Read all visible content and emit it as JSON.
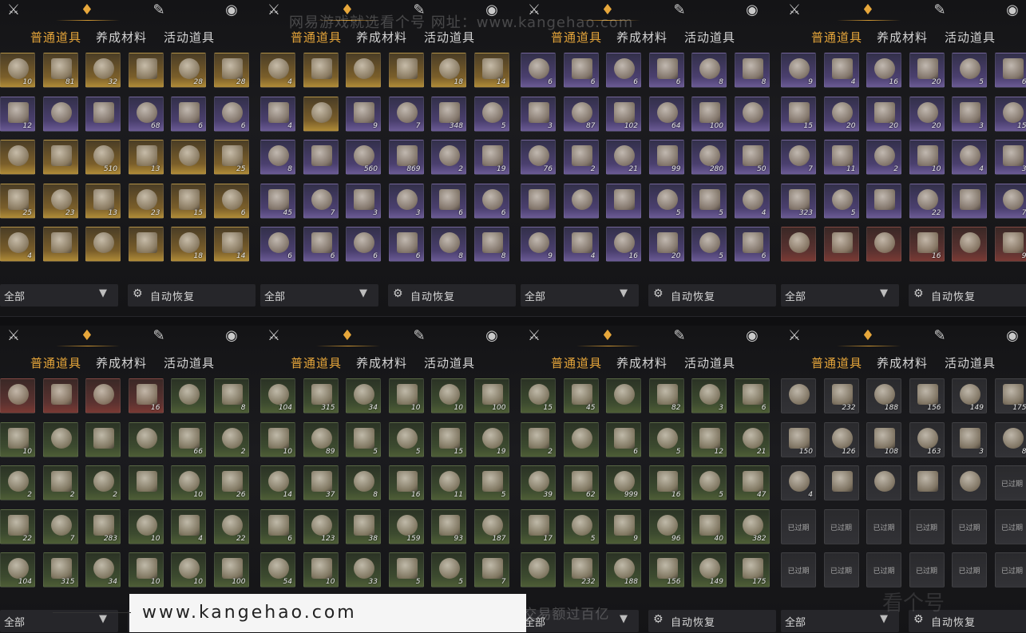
{
  "tabs": [
    "普通道具",
    "养成材料",
    "活动道具"
  ],
  "filter_label": "全部",
  "auto_restore_label": "自动恢复",
  "watermark_top": "网易游戏就选看个号  网址：www.kangehao.com",
  "watermark_bottom": "一号一号专业网易游戏八年  年交易额过百亿",
  "watermark_logo": "看个号",
  "url_banner": "www.kangehao.com",
  "panels": [
    {
      "rows": [
        [
          [
            "gold",
            "10"
          ],
          [
            "gold",
            "81"
          ],
          [
            "gold",
            "32"
          ],
          [
            "gold",
            ""
          ],
          [
            "gold",
            "28"
          ],
          [
            "gold",
            "28"
          ]
        ],
        [
          [
            "purple",
            "12"
          ],
          [
            "purple",
            ""
          ],
          [
            "purple",
            ""
          ],
          [
            "purple",
            "68"
          ],
          [
            "purple",
            "6"
          ],
          [
            "purple",
            "6"
          ]
        ],
        [
          [
            "gold",
            ""
          ],
          [
            "gold",
            ""
          ],
          [
            "gold",
            "510"
          ],
          [
            "gold",
            "13"
          ],
          [
            "gold",
            ""
          ],
          [
            "gold",
            "25"
          ]
        ],
        [
          [
            "gold",
            "25"
          ],
          [
            "gold",
            "23"
          ],
          [
            "gold",
            "13"
          ],
          [
            "gold",
            "23"
          ],
          [
            "gold",
            "15"
          ],
          [
            "gold",
            "6"
          ]
        ],
        [
          [
            "gold",
            "4"
          ],
          [
            "gold",
            ""
          ],
          [
            "gold",
            ""
          ],
          [
            "gold",
            ""
          ],
          [
            "gold",
            "18"
          ],
          [
            "gold",
            "14"
          ]
        ]
      ]
    },
    {
      "rows": [
        [
          [
            "gold",
            "4"
          ],
          [
            "gold",
            ""
          ],
          [
            "gold",
            ""
          ],
          [
            "gold",
            ""
          ],
          [
            "gold",
            "18"
          ],
          [
            "gold",
            "14"
          ]
        ],
        [
          [
            "purple",
            "4"
          ],
          [
            "gold",
            ""
          ],
          [
            "purple",
            "9"
          ],
          [
            "purple",
            "7"
          ],
          [
            "purple",
            "348"
          ],
          [
            "purple",
            "5"
          ]
        ],
        [
          [
            "purple",
            "8"
          ],
          [
            "purple",
            ""
          ],
          [
            "purple",
            "560"
          ],
          [
            "purple",
            "869"
          ],
          [
            "purple",
            "2"
          ],
          [
            "purple",
            "19"
          ]
        ],
        [
          [
            "purple",
            "45"
          ],
          [
            "purple",
            "7"
          ],
          [
            "purple",
            "3"
          ],
          [
            "purple",
            "3"
          ],
          [
            "purple",
            "6"
          ],
          [
            "purple",
            "6"
          ]
        ],
        [
          [
            "purple",
            "6"
          ],
          [
            "purple",
            "6"
          ],
          [
            "purple",
            "6"
          ],
          [
            "purple",
            "6"
          ],
          [
            "purple",
            "8"
          ],
          [
            "purple",
            "8"
          ]
        ]
      ]
    },
    {
      "rows": [
        [
          [
            "purple",
            "6"
          ],
          [
            "purple",
            "6"
          ],
          [
            "purple",
            "6"
          ],
          [
            "purple",
            "6"
          ],
          [
            "purple",
            "8"
          ],
          [
            "purple",
            "8"
          ]
        ],
        [
          [
            "purple",
            "3"
          ],
          [
            "purple",
            "87"
          ],
          [
            "purple",
            "102"
          ],
          [
            "purple",
            "64"
          ],
          [
            "purple",
            "100"
          ],
          [
            "purple",
            ""
          ]
        ],
        [
          [
            "purple",
            "76"
          ],
          [
            "purple",
            "2"
          ],
          [
            "purple",
            "21"
          ],
          [
            "purple",
            "99"
          ],
          [
            "purple",
            "280"
          ],
          [
            "purple",
            "50"
          ]
        ],
        [
          [
            "purple",
            ""
          ],
          [
            "purple",
            ""
          ],
          [
            "purple",
            ""
          ],
          [
            "purple",
            "5"
          ],
          [
            "purple",
            "5"
          ],
          [
            "purple",
            "4"
          ]
        ],
        [
          [
            "purple",
            "9"
          ],
          [
            "purple",
            "4"
          ],
          [
            "purple",
            "16"
          ],
          [
            "purple",
            "20"
          ],
          [
            "purple",
            "5"
          ],
          [
            "purple",
            "6"
          ]
        ]
      ]
    },
    {
      "rows": [
        [
          [
            "purple",
            "9"
          ],
          [
            "purple",
            "4"
          ],
          [
            "purple",
            "16"
          ],
          [
            "purple",
            "20"
          ],
          [
            "purple",
            "5"
          ],
          [
            "purple",
            "6"
          ]
        ],
        [
          [
            "purple",
            "15"
          ],
          [
            "purple",
            "20"
          ],
          [
            "purple",
            "20"
          ],
          [
            "purple",
            "20"
          ],
          [
            "purple",
            "3"
          ],
          [
            "purple",
            "15"
          ]
        ],
        [
          [
            "purple",
            "7"
          ],
          [
            "purple",
            "11"
          ],
          [
            "purple",
            "2"
          ],
          [
            "purple",
            "10"
          ],
          [
            "purple",
            "4"
          ],
          [
            "purple",
            "3"
          ]
        ],
        [
          [
            "purple",
            "323"
          ],
          [
            "purple",
            "5"
          ],
          [
            "purple",
            ""
          ],
          [
            "purple",
            "22"
          ],
          [
            "purple",
            ""
          ],
          [
            "purple",
            "7"
          ]
        ],
        [
          [
            "red",
            ""
          ],
          [
            "red",
            ""
          ],
          [
            "red",
            ""
          ],
          [
            "red",
            "16"
          ],
          [
            "red",
            ""
          ],
          [
            "red",
            "9"
          ]
        ]
      ]
    },
    {
      "rows": [
        [
          [
            "red",
            ""
          ],
          [
            "red",
            ""
          ],
          [
            "red",
            ""
          ],
          [
            "red",
            "16"
          ],
          [
            "green",
            ""
          ],
          [
            "green",
            "8"
          ]
        ],
        [
          [
            "green",
            "10"
          ],
          [
            "green",
            ""
          ],
          [
            "green",
            ""
          ],
          [
            "green",
            ""
          ],
          [
            "green",
            "66"
          ],
          [
            "green",
            "2"
          ]
        ],
        [
          [
            "green",
            "2"
          ],
          [
            "green",
            "2"
          ],
          [
            "green",
            "2"
          ],
          [
            "green",
            ""
          ],
          [
            "green",
            "10"
          ],
          [
            "green",
            "26"
          ]
        ],
        [
          [
            "green",
            "22"
          ],
          [
            "green",
            "7"
          ],
          [
            "green",
            "283"
          ],
          [
            "green",
            "10"
          ],
          [
            "green",
            "4"
          ],
          [
            "green",
            "22"
          ]
        ],
        [
          [
            "green",
            "104"
          ],
          [
            "green",
            "315"
          ],
          [
            "green",
            "34"
          ],
          [
            "green",
            "10"
          ],
          [
            "green",
            "10"
          ],
          [
            "green",
            "100"
          ]
        ]
      ]
    },
    {
      "rows": [
        [
          [
            "green",
            "104"
          ],
          [
            "green",
            "315"
          ],
          [
            "green",
            "34"
          ],
          [
            "green",
            "10"
          ],
          [
            "green",
            "10"
          ],
          [
            "green",
            "100"
          ]
        ],
        [
          [
            "green",
            "10"
          ],
          [
            "green",
            "89"
          ],
          [
            "green",
            "5"
          ],
          [
            "green",
            "5"
          ],
          [
            "green",
            "15"
          ],
          [
            "green",
            "19"
          ]
        ],
        [
          [
            "green",
            "14"
          ],
          [
            "green",
            "37"
          ],
          [
            "green",
            "8"
          ],
          [
            "green",
            "16"
          ],
          [
            "green",
            "11"
          ],
          [
            "green",
            "5"
          ]
        ],
        [
          [
            "green",
            "6"
          ],
          [
            "green",
            "123"
          ],
          [
            "green",
            "38"
          ],
          [
            "green",
            "159"
          ],
          [
            "green",
            "93"
          ],
          [
            "green",
            "187"
          ]
        ],
        [
          [
            "green",
            "54"
          ],
          [
            "green",
            "10"
          ],
          [
            "green",
            "33"
          ],
          [
            "green",
            "5"
          ],
          [
            "green",
            "5"
          ],
          [
            "green",
            "7"
          ]
        ]
      ]
    },
    {
      "rows": [
        [
          [
            "green",
            "15"
          ],
          [
            "green",
            "45"
          ],
          [
            "green",
            ""
          ],
          [
            "green",
            "82"
          ],
          [
            "green",
            "3"
          ],
          [
            "green",
            "6"
          ]
        ],
        [
          [
            "green",
            "2"
          ],
          [
            "green",
            ""
          ],
          [
            "green",
            "6"
          ],
          [
            "green",
            "5"
          ],
          [
            "green",
            "12"
          ],
          [
            "green",
            "21"
          ]
        ],
        [
          [
            "green",
            "39"
          ],
          [
            "green",
            "62"
          ],
          [
            "green",
            "999"
          ],
          [
            "green",
            "16"
          ],
          [
            "green",
            "5"
          ],
          [
            "green",
            "47"
          ]
        ],
        [
          [
            "green",
            "17"
          ],
          [
            "green",
            "5"
          ],
          [
            "green",
            "9"
          ],
          [
            "green",
            "96"
          ],
          [
            "green",
            "40"
          ],
          [
            "green",
            "382"
          ]
        ],
        [
          [
            "green",
            ""
          ],
          [
            "green",
            "232"
          ],
          [
            "green",
            "188"
          ],
          [
            "green",
            "156"
          ],
          [
            "green",
            "149"
          ],
          [
            "green",
            "175"
          ]
        ]
      ]
    },
    {
      "rows": [
        [
          [
            "gray",
            ""
          ],
          [
            "gray",
            "232"
          ],
          [
            "gray",
            "188"
          ],
          [
            "gray",
            "156"
          ],
          [
            "gray",
            "149"
          ],
          [
            "gray",
            "175"
          ]
        ],
        [
          [
            "gray",
            "150"
          ],
          [
            "gray",
            "126"
          ],
          [
            "gray",
            "108"
          ],
          [
            "gray",
            "163"
          ],
          [
            "gray",
            "3"
          ],
          [
            "gray",
            "8"
          ]
        ],
        [
          [
            "gray",
            "4"
          ],
          [
            "gray",
            ""
          ],
          [
            "gray",
            ""
          ],
          [
            "gray",
            ""
          ],
          [
            "gray",
            ""
          ],
          [
            "gray",
            "已过期"
          ]
        ],
        [
          [
            "gray",
            "已过期"
          ],
          [
            "gray",
            "已过期"
          ],
          [
            "gray",
            "已过期"
          ],
          [
            "gray",
            "已过期"
          ],
          [
            "gray",
            "已过期"
          ],
          [
            "gray",
            "已过期"
          ]
        ],
        [
          [
            "gray",
            "已过期"
          ],
          [
            "gray",
            "已过期"
          ],
          [
            "gray",
            "已过期"
          ],
          [
            "gray",
            "已过期"
          ],
          [
            "gray",
            "已过期"
          ],
          [
            "gray",
            "已过期"
          ]
        ]
      ]
    }
  ]
}
